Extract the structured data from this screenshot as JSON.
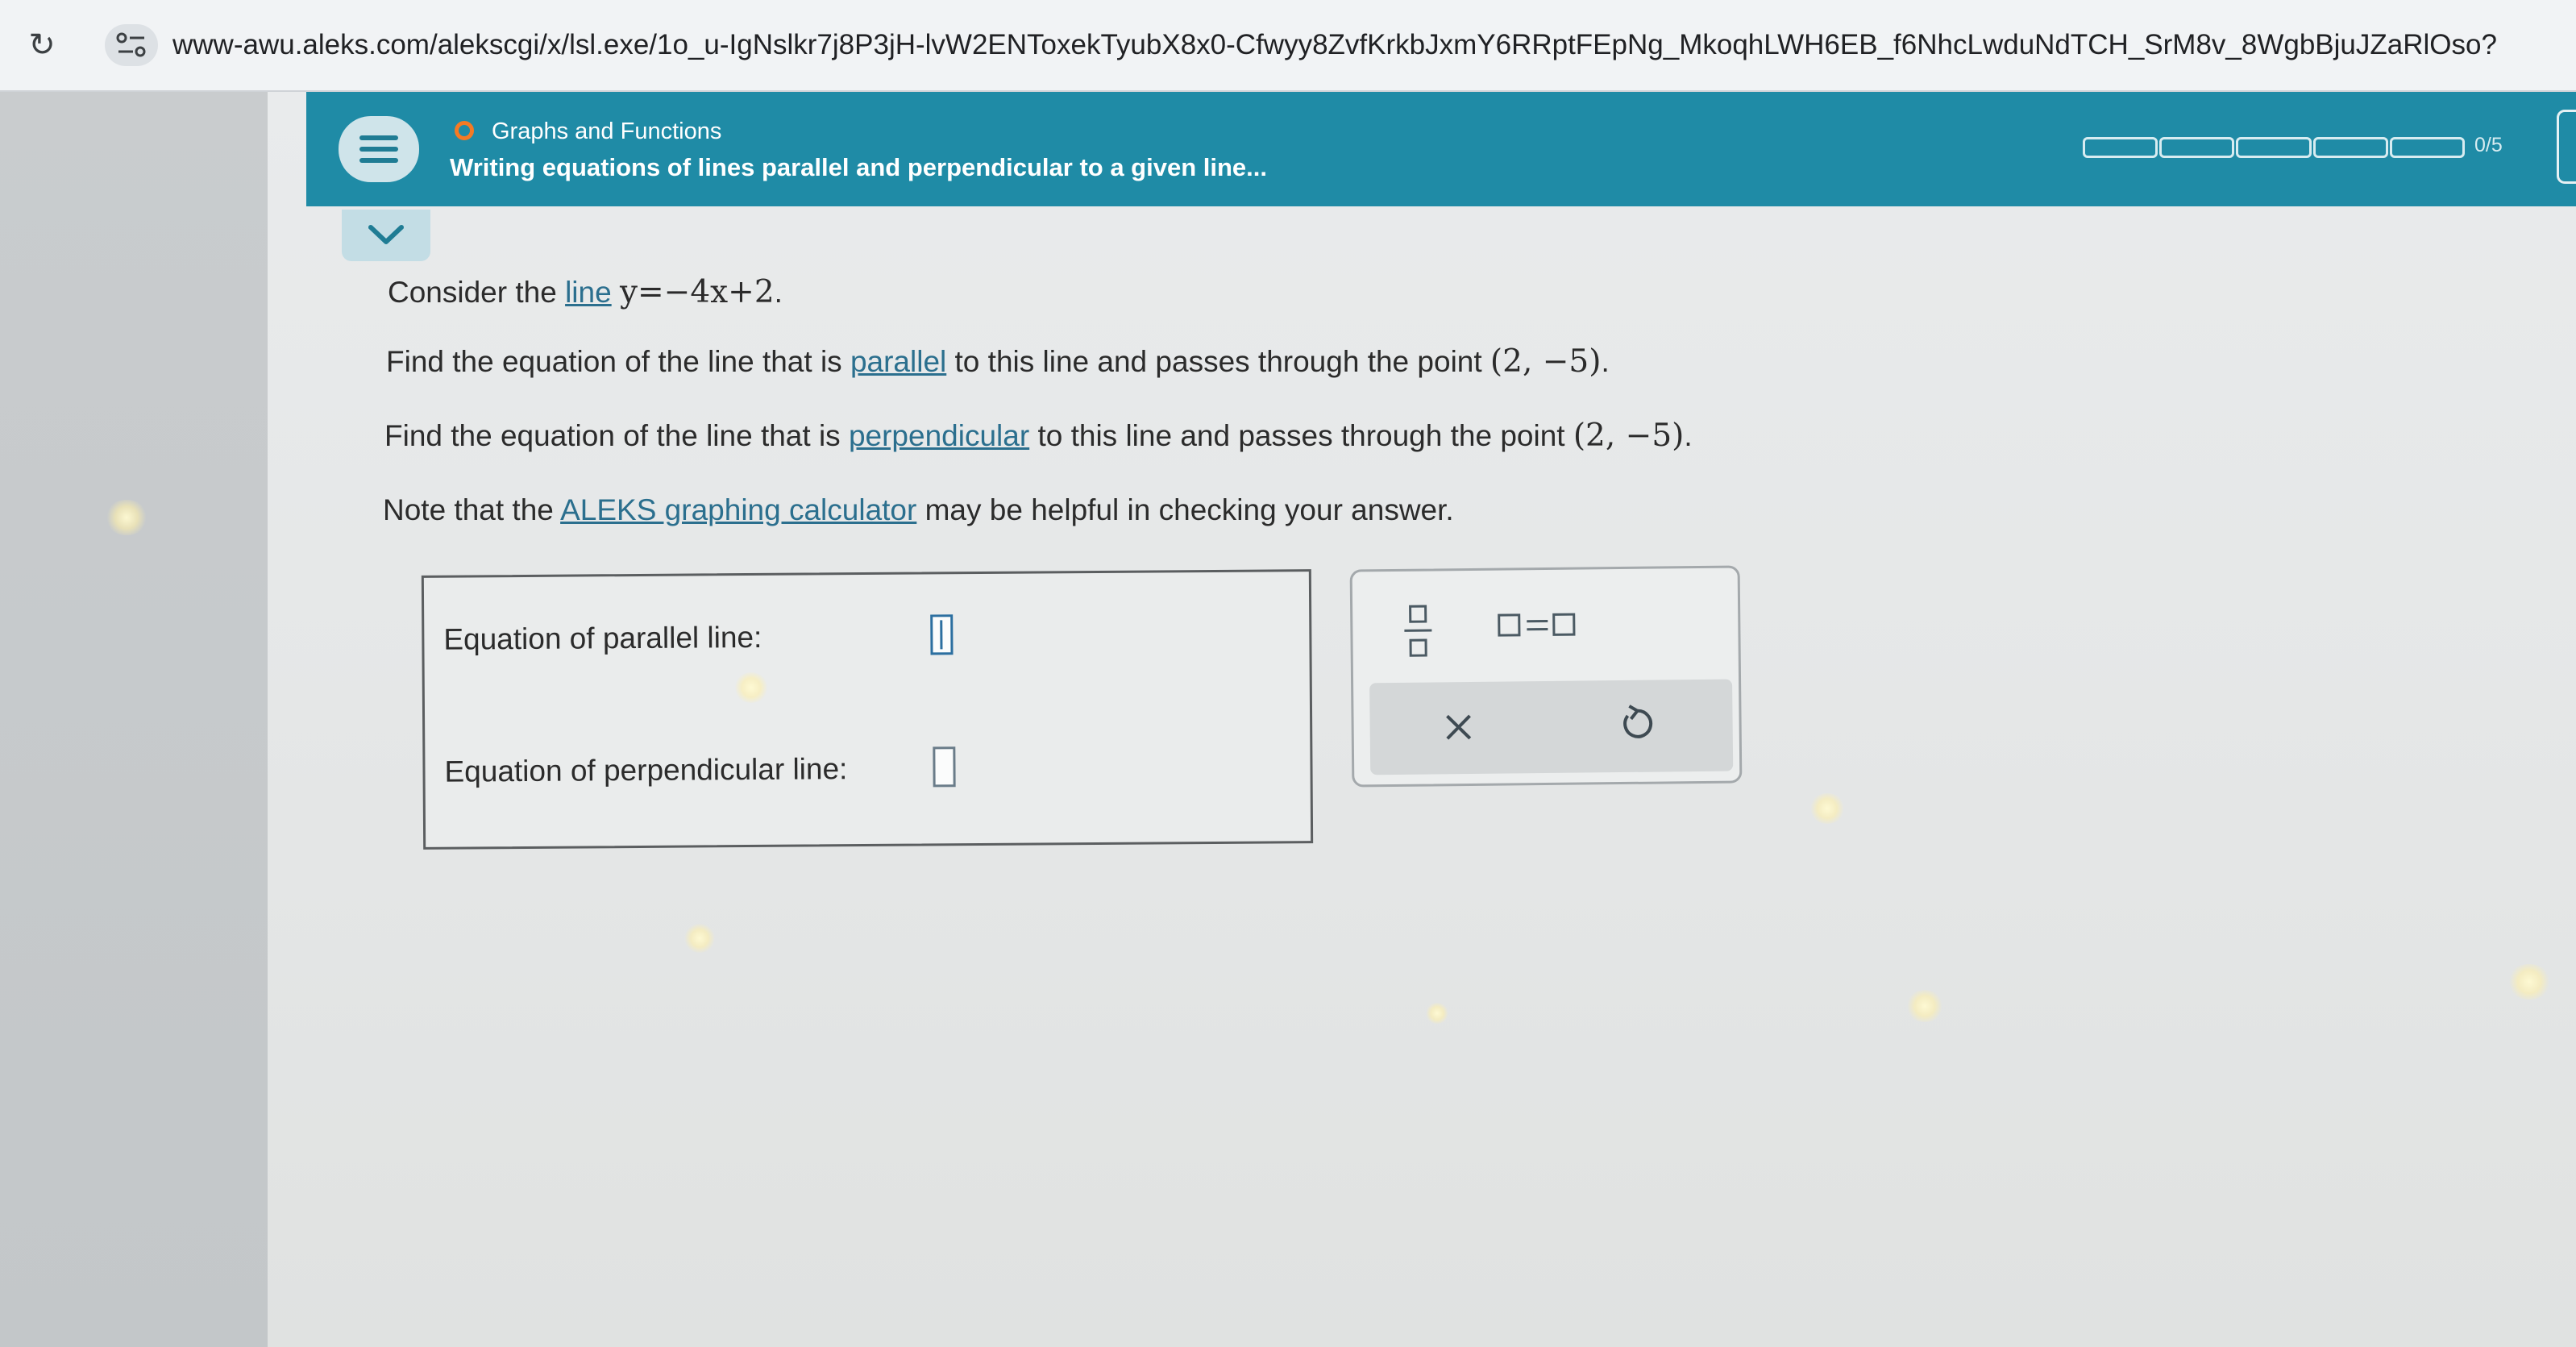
{
  "browser": {
    "url": "www-awu.aleks.com/alekscgi/x/lsl.exe/1o_u-IgNslkr7j8P3jH-lvW2ENToxekTyubX8x0-Cfwyy8ZvfKrkbJxmY6RRptFEpNg_MkoqhLWH6EB_f6NhcLwduNdTCH_SrM8v_8WgbBjuJZaRlOso?"
  },
  "header": {
    "topic": "Graphs and Functions",
    "title": "Writing equations of lines parallel and perpendicular to a given line...",
    "progress_label": "0/5",
    "progress_total": 5,
    "progress_done": 0
  },
  "question": {
    "line1": {
      "pre": "Consider the ",
      "link": "line",
      "math": "y=−4x+2",
      "post": "."
    },
    "line2": {
      "pre": "Find the equation of the line that is ",
      "link": "parallel",
      "mid": " to this line and passes through the point ",
      "point": "(2,  −5)",
      "post": "."
    },
    "line3": {
      "pre": "Find the equation of the line that is ",
      "link": "perpendicular",
      "mid": " to this line and passes through the point ",
      "point": "(2,  −5)",
      "post": "."
    },
    "line4": {
      "pre": "Note that the ",
      "link": "ALEKS graphing calculator",
      "post": " may be helpful in checking your answer."
    }
  },
  "answer": {
    "parallel_label": "Equation of parallel line:",
    "parallel_value": "",
    "perpendicular_label": "Equation of perpendicular line:",
    "perpendicular_value": ""
  },
  "keypad": {
    "keys": [
      "fraction-key",
      "equation-key",
      "clear-key",
      "undo-key"
    ],
    "clear_symbol": "×",
    "undo_symbol": "↺"
  },
  "colors": {
    "header": "#1f8ba6",
    "topic_dot": "#f47a24",
    "link": "#2b6f8e"
  }
}
